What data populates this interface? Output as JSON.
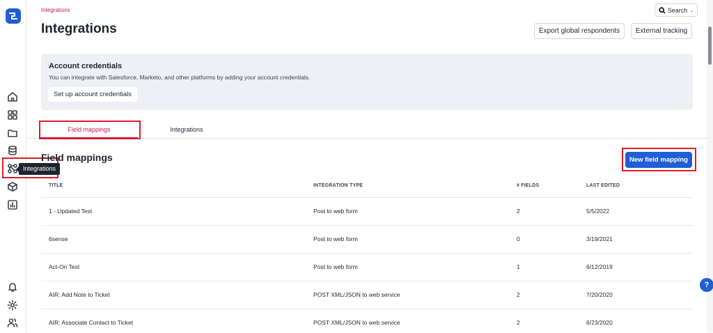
{
  "breadcrumb": "Integrations",
  "page_title": "Integrations",
  "search": {
    "label": "Search"
  },
  "header_buttons": {
    "export": "Export global respondents",
    "external": "External tracking"
  },
  "credentials": {
    "title": "Account credentials",
    "description": "You can integrate with Salesforce, Marketo, and other platforms by adding your account credentials.",
    "button": "Set up account credentials"
  },
  "sidebar": {
    "tooltip": "Integrations"
  },
  "tabs": [
    {
      "label": "Field mappings"
    },
    {
      "label": "Integrations"
    }
  ],
  "section": {
    "title": "Field mappings",
    "new_button": "New field mapping"
  },
  "table": {
    "headers": [
      "TITLE",
      "INTEGRATION TYPE",
      "# FIELDS",
      "LAST EDITED"
    ],
    "rows": [
      {
        "title": "1 - Updated Test",
        "type": "Post to web form",
        "fields": "2",
        "edited": "5/5/2022"
      },
      {
        "title": "6sense",
        "type": "Post to web form",
        "fields": "0",
        "edited": "3/19/2021"
      },
      {
        "title": "Act-On Test",
        "type": "Post to web form",
        "fields": "1",
        "edited": "6/12/2019"
      },
      {
        "title": "AIR: Add Note to Ticket",
        "type": "POST XML/JSON to web service",
        "fields": "2",
        "edited": "7/20/2020"
      },
      {
        "title": "AIR: Associate Contact to Ticket",
        "type": "POST XML/JSON to web service",
        "fields": "2",
        "edited": "6/23/2020"
      }
    ]
  },
  "help": "?",
  "colors": {
    "accent": "#c2185b",
    "primary": "#1f5fd6",
    "highlight": "#e01b24"
  }
}
